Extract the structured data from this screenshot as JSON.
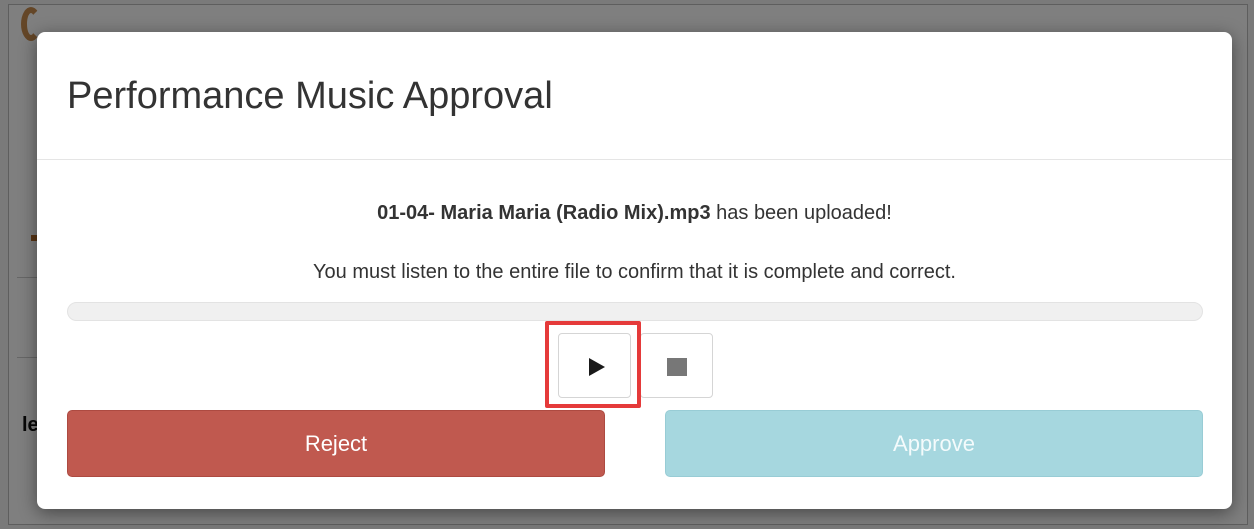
{
  "background": {
    "fragment_text": "le"
  },
  "modal": {
    "title": "Performance Music Approval",
    "upload": {
      "filename": "01-04- Maria Maria (Radio Mix).mp3",
      "suffix": " has been uploaded!"
    },
    "instruction": "You must listen to the entire file to confirm that it is complete and correct.",
    "progress": 0,
    "controls": {
      "play_icon": "play-icon",
      "stop_icon": "stop-icon"
    },
    "buttons": {
      "reject_label": "Reject",
      "approve_label": "Approve"
    }
  },
  "colors": {
    "reject": "#c0594f",
    "approve_disabled": "#a6d7df",
    "highlight": "#e53a3a"
  }
}
